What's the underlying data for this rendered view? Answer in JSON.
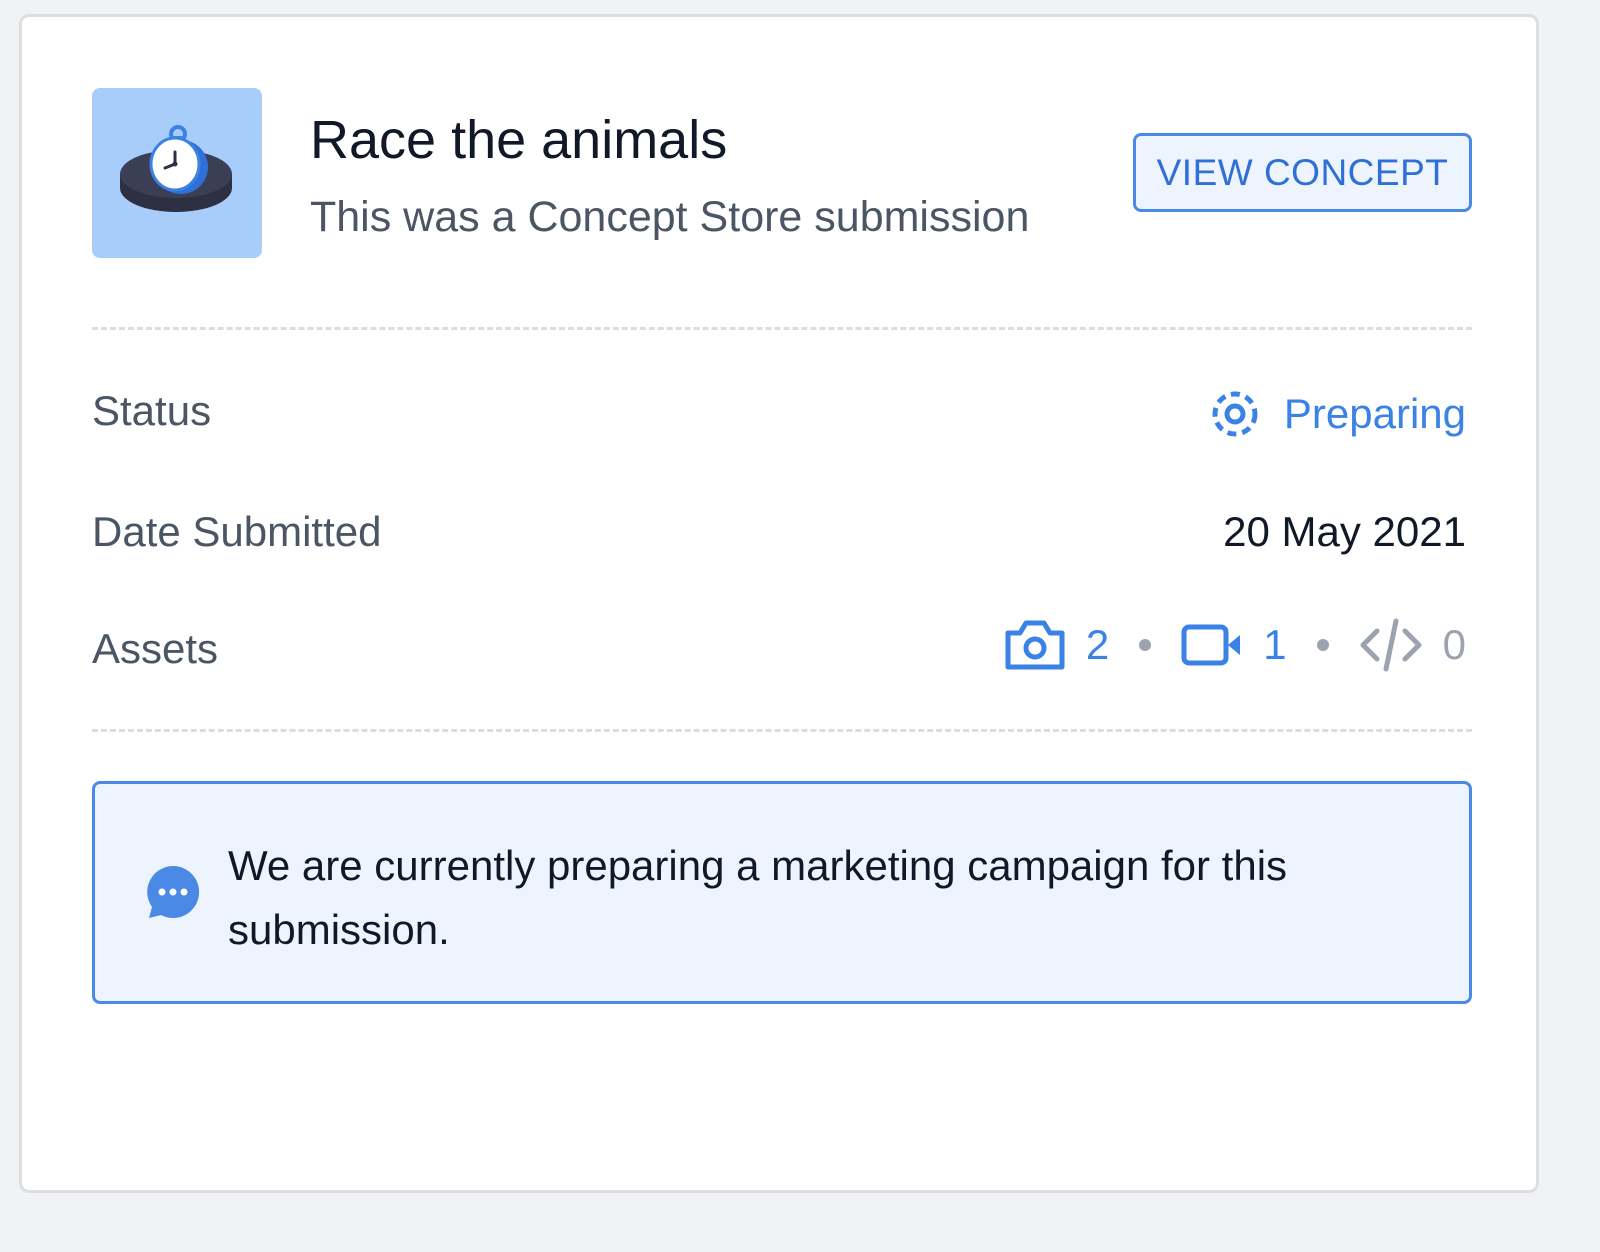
{
  "submission": {
    "title": "Race the animals",
    "subtitle": "This was a Concept Store submission",
    "thumbnail_icon": "stopwatch-icon",
    "view_button_label": "VIEW CONCEPT"
  },
  "details": {
    "status_label": "Status",
    "status_value": "Preparing",
    "status_icon": "dashed-circle-icon",
    "date_label": "Date Submitted",
    "date_value": "20 May 2021",
    "assets_label": "Assets",
    "assets": {
      "photos": "2",
      "videos": "1",
      "code": "0"
    }
  },
  "notice": {
    "icon": "chat-bubble-icon",
    "text": "We are currently preparing a marketing campaign for this submission."
  },
  "colors": {
    "accent": "#3b82e6",
    "notice_background": "#eef4fd",
    "thumbnail_background": "#a8cdfb",
    "muted": "#9ca3af"
  }
}
